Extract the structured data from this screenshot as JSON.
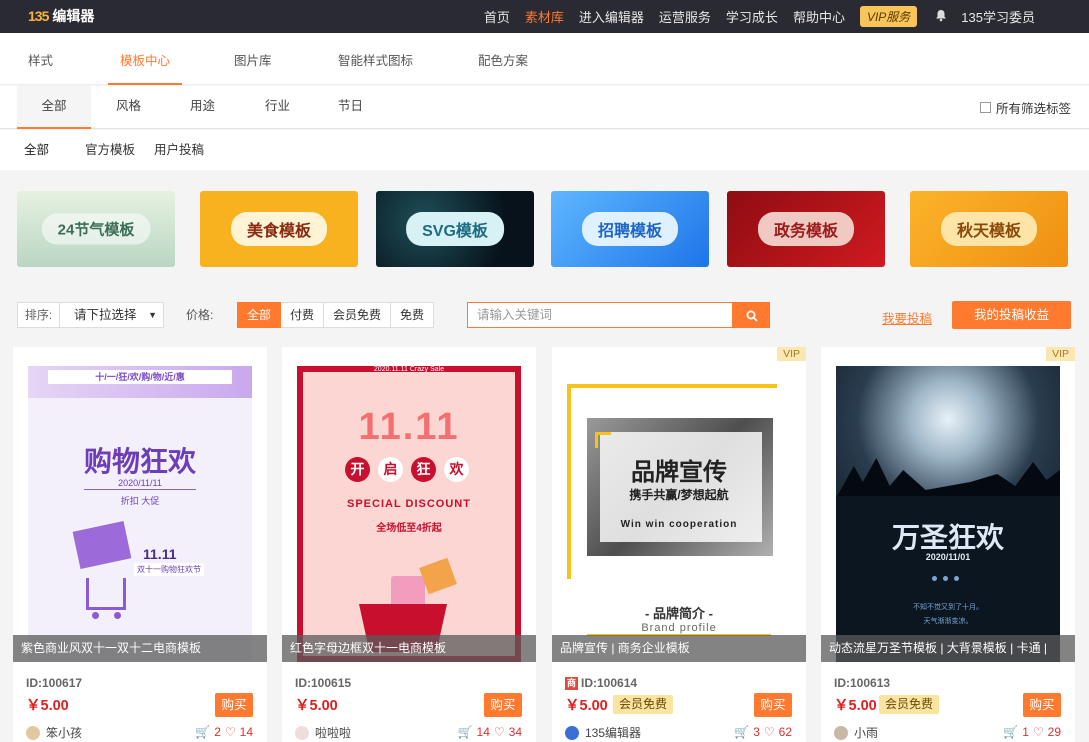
{
  "topbar": {
    "logo_mark": "135",
    "logo_text": "编辑器",
    "nav": [
      "首页",
      "素材库",
      "进入编辑器",
      "运营服务",
      "学习成长",
      "帮助中心"
    ],
    "nav_active": 1,
    "vip": "VIP服务",
    "user": "135学习委员"
  },
  "tabs1": [
    "样式",
    "模板中心",
    "图片库",
    "智能样式图标",
    "配色方案"
  ],
  "tabs2": [
    "全部",
    "风格",
    "用途",
    "行业",
    "节日"
  ],
  "filter_all": "所有筛选标签",
  "tabs3": [
    "全部",
    "官方模板",
    "用户投稿"
  ],
  "banners": [
    {
      "label": "24节气模板",
      "bg": "#dbe9d6"
    },
    {
      "label": "美食模板",
      "bg": "#f7b21e"
    },
    {
      "label": "SVG模板",
      "bg": "#0d1a22"
    },
    {
      "label": "招聘模板",
      "bg": "#2c8cf0"
    },
    {
      "label": "政务模板",
      "bg": "#b3121a"
    },
    {
      "label": "秋天模板",
      "bg": "#f8a21a"
    }
  ],
  "toolbar": {
    "sort_label": "排序:",
    "sort_value": "请下拉选择",
    "price_label": "价格:",
    "price_options": [
      "全部",
      "付费",
      "会员免费",
      "免费"
    ],
    "search_placeholder": "请输入关键词",
    "contribute": "我要投稿",
    "earnings": "我的投稿收益"
  },
  "cards": [
    {
      "title": "紫色商业风双十一双十二电商模板",
      "id": "ID:100617",
      "price": "￥5.00",
      "member": "",
      "vip": "",
      "author": "笨小孩",
      "buys": "2",
      "likes": "14",
      "buy_label": "购买",
      "thumb": {
        "banner": "十/一/狂/欢/购/物/近/惠",
        "big": "购物狂欢",
        "date": "2020/11/11",
        "sub": "折扣 大促",
        "promo": "11.11",
        "promo_sub": "双十一购物狂欢节"
      }
    },
    {
      "title": "红色字母边框双十一电商模板",
      "id": "ID:100615",
      "price": "￥5.00",
      "member": "",
      "vip": "",
      "author": "啦啦啦",
      "buys": "14",
      "likes": "34",
      "buy_label": "购买",
      "thumb": {
        "big": "11.11",
        "chars": [
          "开",
          "启",
          "狂",
          "欢"
        ],
        "sub": "SPECIAL DISCOUNT",
        "sub2": "全场低至4折起",
        "edge": "2020.11.11   Crazy Sale"
      }
    },
    {
      "title": "品牌宣传 | 商务企业模板",
      "id": "ID:100614",
      "price": "￥5.00",
      "member": "会员免费",
      "vip": "VIP",
      "author": "135编辑器",
      "buys": "3",
      "likes": "62",
      "buy_label": "购买",
      "thumb": {
        "big": "品牌宣传",
        "sub": "携手共赢/梦想起航",
        "en": "Win win cooperation",
        "foot": "- 品牌简介 -",
        "foot_en": "Brand profile"
      }
    },
    {
      "title": "动态流星万圣节模板 | 大背景模板 | 卡通 |",
      "id": "ID:100613",
      "price": "￥5.00",
      "member": "会员免费",
      "vip": "VIP",
      "author": "小雨",
      "buys": "1",
      "likes": "29",
      "buy_label": "购买",
      "thumb": {
        "big": "万圣狂欢",
        "date": "2020/11/01",
        "small": "不知不觉又到了十月。",
        "small2": "天气渐渐变凉。"
      }
    }
  ]
}
